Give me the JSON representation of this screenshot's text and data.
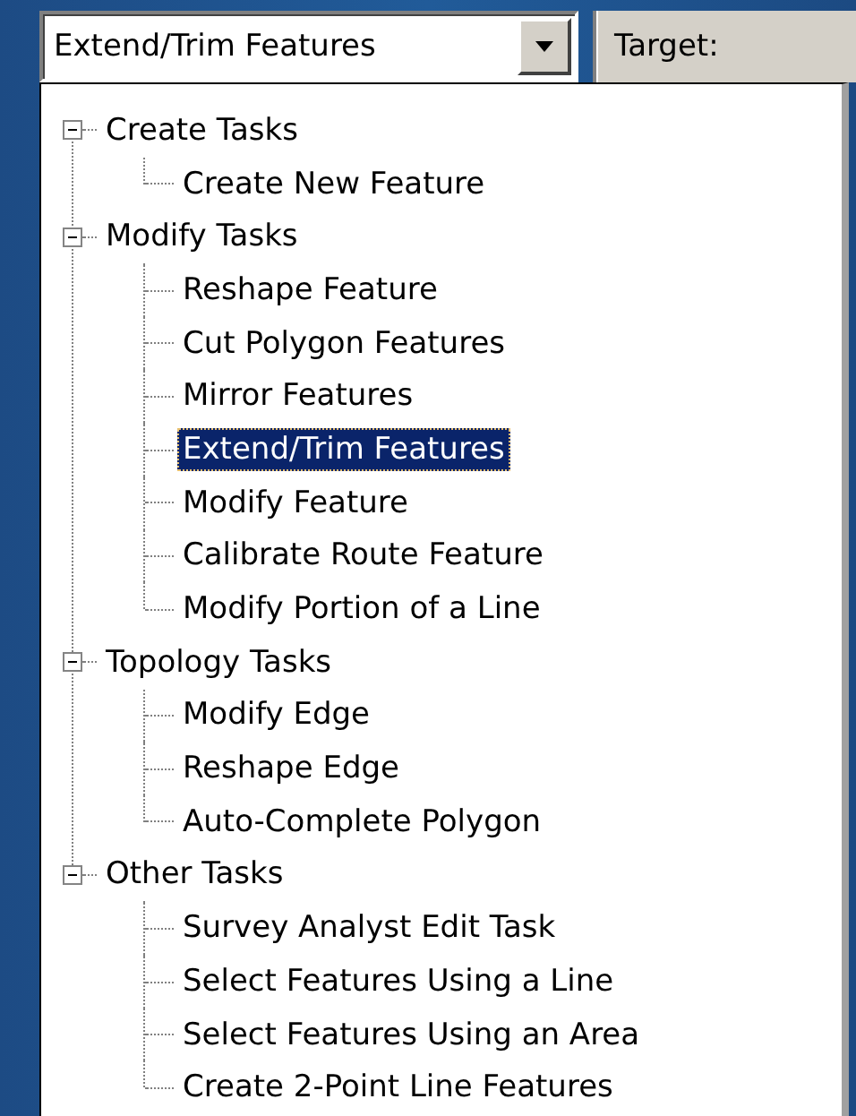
{
  "task_combo": {
    "value": "Extend/Trim Features"
  },
  "target_label": "Target:",
  "task_tree": [
    {
      "label": "Create Tasks",
      "expanded": true,
      "selected": false,
      "children": [
        {
          "label": "Create New Feature",
          "selected": false
        }
      ]
    },
    {
      "label": "Modify Tasks",
      "expanded": true,
      "selected": false,
      "children": [
        {
          "label": "Reshape Feature",
          "selected": false
        },
        {
          "label": "Cut Polygon Features",
          "selected": false
        },
        {
          "label": "Mirror Features",
          "selected": false
        },
        {
          "label": "Extend/Trim Features",
          "selected": true
        },
        {
          "label": "Modify Feature",
          "selected": false
        },
        {
          "label": "Calibrate Route Feature",
          "selected": false
        },
        {
          "label": "Modify Portion of a Line",
          "selected": false
        }
      ]
    },
    {
      "label": "Topology Tasks",
      "expanded": true,
      "selected": false,
      "children": [
        {
          "label": "Modify Edge",
          "selected": false
        },
        {
          "label": "Reshape Edge",
          "selected": false
        },
        {
          "label": "Auto-Complete Polygon",
          "selected": false
        }
      ]
    },
    {
      "label": "Other Tasks",
      "expanded": true,
      "selected": false,
      "children": [
        {
          "label": "Survey Analyst Edit Task",
          "selected": false
        },
        {
          "label": "Select Features Using a Line",
          "selected": false
        },
        {
          "label": "Select Features Using an Area",
          "selected": false
        },
        {
          "label": "Create 2-Point Line Features",
          "selected": false
        }
      ]
    }
  ]
}
